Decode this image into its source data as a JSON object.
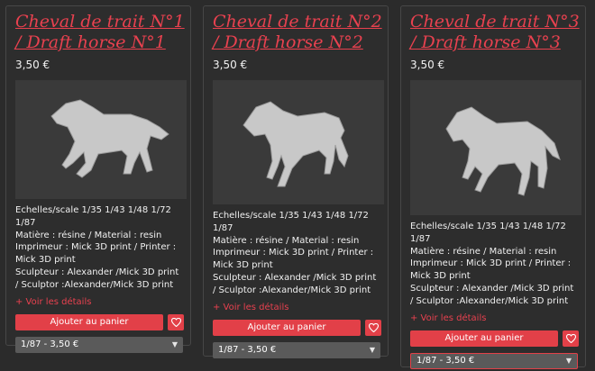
{
  "products": [
    {
      "title": "Cheval de trait N°1 / Draft horse N°1",
      "price": "3,50 €",
      "desc": [
        "Echelles/scale 1/35 1/43 1/48 1/72 1/87",
        "Matière : résine / Material : resin",
        "Imprimeur : Mick 3D print / Printer : Mick 3D print",
        "Sculpteur : Alexander /Mick 3D print / Sculptor :Alexander/Mick 3D print"
      ],
      "more": "+ Voir les détails",
      "cart": "Ajouter au panier",
      "select": "1/87 - 3,50 €"
    },
    {
      "title": "Cheval de trait N°2 / Draft horse N°2",
      "price": "3,50 €",
      "desc": [
        "Echelles/scale 1/35 1/43 1/48 1/72 1/87",
        "Matière : résine / Material : resin",
        "Imprimeur : Mick 3D print / Printer : Mick 3D print",
        "Sculpteur : Alexander /Mick 3D print / Sculptor :Alexander/Mick 3D print"
      ],
      "more": "+ Voir les détails",
      "cart": "Ajouter au panier",
      "select": "1/87 - 3,50 €"
    },
    {
      "title": "Cheval de trait N°3 / Draft horse N°3",
      "price": "3,50 €",
      "desc": [
        "Echelles/scale 1/35 1/43 1/48 1/72 1/87",
        "Matière : résine / Material : resin",
        "Imprimeur : Mick 3D print / Printer : Mick 3D print",
        "Sculpteur : Alexander /Mick 3D print / Sculptor :Alexander/Mick 3D print"
      ],
      "more": "+ Voir les détails",
      "cart": "Ajouter au panier",
      "select": "1/87 - 3,50 €"
    }
  ],
  "icons": {
    "heart": "heart-icon",
    "caret": "caret-down-icon"
  },
  "colors": {
    "accent": "#e24048",
    "background": "#2b2b2b",
    "select": "#5a5a5a"
  }
}
